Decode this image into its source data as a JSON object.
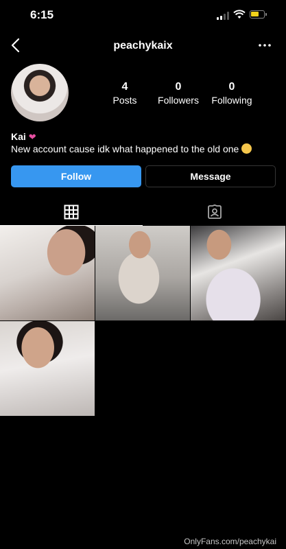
{
  "status_bar": {
    "time": "6:15"
  },
  "header": {
    "username": "peachykaix"
  },
  "profile": {
    "stats": [
      {
        "count": "4",
        "label": "Posts"
      },
      {
        "count": "0",
        "label": "Followers"
      },
      {
        "count": "0",
        "label": "Following"
      }
    ],
    "name": "Kai",
    "bio": "New account cause idk what happened to the old one"
  },
  "actions": {
    "follow_label": "Follow",
    "message_label": "Message"
  },
  "tabs": [
    {
      "icon": "grid-icon",
      "active": true
    },
    {
      "icon": "tagged-icon",
      "active": false
    }
  ],
  "posts": [
    {
      "name": "post-1"
    },
    {
      "name": "post-2"
    },
    {
      "name": "post-3"
    },
    {
      "name": "post-4"
    }
  ],
  "watermark": "OnlyFans.com/peachykai",
  "colors": {
    "follow_button": "#3797f0",
    "background": "#000000",
    "battery": "#f2d21b"
  }
}
